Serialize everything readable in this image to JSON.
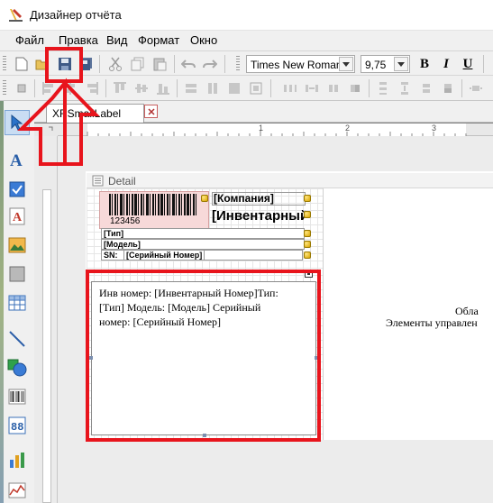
{
  "window": {
    "title": "Дизайнер отчёта"
  },
  "menu": [
    "Файл",
    "Правка",
    "Вид",
    "Формат",
    "Окно"
  ],
  "toolbar": {
    "font_name": "Times New Roman",
    "font_size": "9,75",
    "bold_label": "B",
    "italic_label": "I",
    "underline_label": "U"
  },
  "tab": {
    "label": "XRSmallLabel",
    "close_symbol": "×"
  },
  "band": {
    "title": "Detail"
  },
  "barcode": {
    "number": "123456"
  },
  "fields": {
    "company": "[Компания]",
    "inventory": "[Инвентарный",
    "type": "[Тип]",
    "model": "[Модель]",
    "sn_label": "SN:",
    "serial": "[Серийный Номер]"
  },
  "memo": {
    "line1": "Инв номер: [Инвентарный Номер]Тип:",
    "line2": "[Тип] Модель: [Модель] Серийный",
    "line3": "номер: [Серийный Номер]"
  },
  "right_panel": {
    "line1": "Обла",
    "line2": "Элементы управлен"
  },
  "ruler": {
    "mark1": "1",
    "mark2": "2",
    "mark3": "3"
  },
  "colors": {
    "highlight": "#e8141c",
    "accent": "#2b73c9"
  }
}
